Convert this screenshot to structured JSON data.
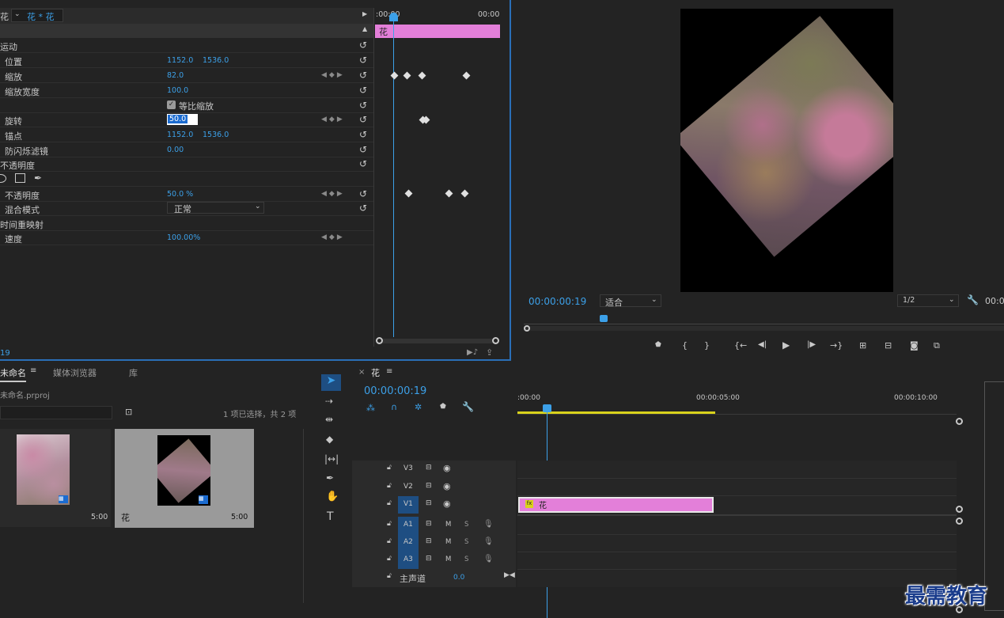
{
  "effect_controls": {
    "source_label": "花",
    "clip_label": "花 * 花",
    "clip_bar_label": "花",
    "ruler_start": ":00:00",
    "ruler_end": "00:00",
    "sections": {
      "motion": "运动",
      "opacity": "不透明度",
      "time_remap": "时间重映射"
    },
    "props": {
      "position": {
        "label": "位置",
        "x": "1152.0",
        "y": "1536.0"
      },
      "scale": {
        "label": "缩放",
        "value": "82.0"
      },
      "scale_width": {
        "label": "缩放宽度",
        "value": "100.0"
      },
      "uniform_scale": "等比缩放",
      "rotation": {
        "label": "旋转",
        "value": "50.0"
      },
      "anchor": {
        "label": "锚点",
        "x": "1152.0",
        "y": "1536.0"
      },
      "antiflicker": {
        "label": "防闪烁滤镜",
        "value": "0.00"
      },
      "opacity": {
        "label": "不透明度",
        "value": "50.0 %"
      },
      "blend": {
        "label": "混合模式",
        "value": "正常"
      },
      "speed": {
        "label": "速度",
        "value": "100.00%"
      }
    },
    "footer_time": "19"
  },
  "program": {
    "timecode": "00:00:00:19",
    "fit": "适合",
    "resolution": "1/2",
    "right_time": "00:0"
  },
  "project": {
    "tab_project": "未命名",
    "tab_media": "媒体浏览器",
    "tab_library": "库",
    "filename": "未命名.prproj",
    "selection": "1 项已选择，共 2 项",
    "items": [
      {
        "name": "",
        "duration": "5:00"
      },
      {
        "name": "花",
        "duration": "5:00"
      }
    ]
  },
  "timeline": {
    "tab": "花",
    "timecode": "00:00:00:19",
    "ruler": [
      ":00:00",
      "00:00:05:00",
      "00:00:10:00"
    ],
    "video_tracks": [
      "V3",
      "V2",
      "V1"
    ],
    "audio_tracks": [
      "A1",
      "A2",
      "A3"
    ],
    "mute": "M",
    "solo": "S",
    "master": "主声道",
    "master_value": "0.0",
    "clip_label": "花"
  },
  "watermark": "最需教育"
}
